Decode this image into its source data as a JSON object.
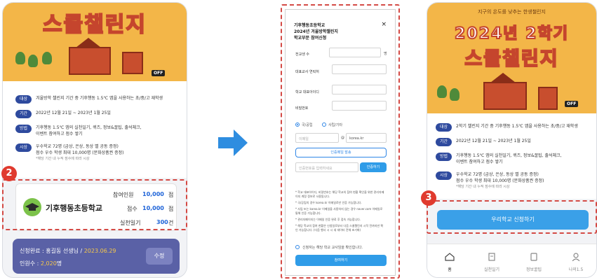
{
  "left": {
    "banner_title": "스쿨챌린지",
    "banner_off": "OFF",
    "info_rows": [
      {
        "tag": "대상",
        "text": "겨울방학 챌린지 기간 중 기후행동 1.5℃ 앱을 사용하는 초/중/고 재학생"
      },
      {
        "tag": "기간",
        "text": "2022년 12월 21일 ~ 2023년 1월 25일"
      },
      {
        "tag": "방법",
        "text": "기후행동 1.5℃ 앱의 실천일기, 퀴즈, 정보&꿀팁, 출석체크,",
        "text2": "이벤트 참여하고 점수 쌓기"
      },
      {
        "tag": "시상",
        "text": "우수학교 72명 (금상, 은상, 동상 별 공동 증정)",
        "text2": "점수 우수 학생 최대 10,000명 (문화상품권 증정)",
        "note": "*해당 기간 내 누적 점수에 따라 시상"
      }
    ],
    "badge": "2",
    "school": {
      "name": "기후행동초등학교",
      "participants_label": "참여인원",
      "participants_value": "10,000",
      "score_label": "점수",
      "score_value": "10,000",
      "days_label": "실천일기",
      "days_value": "300",
      "unit_person": "점",
      "unit_score": "점",
      "unit_days": "건"
    },
    "done": {
      "prefix": "신청완료 : 홍길동 선생님  /",
      "date": "2023.06.29",
      "count_label": "인원수 :",
      "count_value": "2,020",
      "count_unit": "명",
      "edit": "수정"
    }
  },
  "modal": {
    "title1": "기후행동초등학교",
    "title2": "2024년 겨울방학챌린지",
    "title3": "학교부문 참여신청",
    "close": "×",
    "label_students": "전교생 수",
    "unit_students": "명",
    "label_phone": "대표교사 연락처",
    "label_id": "학교 대표아이디",
    "label_pw": "비밀번호",
    "radio1": "국/공립",
    "radio2": "사립/기타",
    "email_placeholder": "이메일",
    "email_at": "@",
    "email_domain": "korea.kr",
    "send_code": "인증메일 발송",
    "code_placeholder": "인증번호를 입력하세요",
    "verify": "인증하기",
    "notes": [
      "* 학교 대표아이디, 비밀번호는 해당 학교의 참여 현황 확인을 위한 관리자페이지 계정 정보로 사용됩니다.",
      "* 국/공립의 경우 korea.kr 이메일로만 인증 가능합니다.",
      "* 사립 또는 korea.kr 이메일을 사용하지 않는 경우 naver.com 이메일로 통해 인증 가능합니다.",
      "* 관리자페이지는 이메일 인증 완료 후 접속 가능합니다.",
      "* 해당 학교의 참여 현황은 신청일로부터 다음 스쿨챌린지 시작 전까지만 확인 가능합니다. (다음 행사 시 시 새 데이터 전체 초기화)"
    ],
    "confirm": "신청자는 해당 학교 교사임을 확인합니다.",
    "submit": "참여하기"
  },
  "right": {
    "banner_sub": "지구의 온도를 낮추는 한생챌린지",
    "banner_year": "2024년 2학기",
    "banner_title": "스쿨챌린지",
    "banner_off": "OFF",
    "info_rows": [
      {
        "tag": "대상",
        "text": "2학기 챌린지 기간 중 기후행동 1.5℃ 앱을 사용하는 초/중/고 재학생"
      },
      {
        "tag": "기간",
        "text": "2022년 12월 21일 ~ 2023년 1월 25일"
      },
      {
        "tag": "방법",
        "text": "기후행동 1.5℃ 앱의 실천일기, 퀴즈, 정보&꿀팁, 출석체크,",
        "text2": "이벤트 참여하고 점수 쌓기"
      },
      {
        "tag": "시상",
        "text": "우수학교 72명 (금상, 은상, 동상 별 공동 증정)",
        "text2": "점수 우수 학생 최대 10,000명 (문화상품권 증정)",
        "note": "*해당 기간 내 누적 점수에 따라 시상"
      }
    ],
    "badge": "3",
    "apply": "우리학교 신청하기",
    "tabs": [
      {
        "label": "홈",
        "icon": "home-icon"
      },
      {
        "label": "실천일기",
        "icon": "diary-icon"
      },
      {
        "label": "정보꿀팁",
        "icon": "tips-icon"
      },
      {
        "label": "나의1.5",
        "icon": "person-icon"
      }
    ]
  },
  "colors": {
    "accent": "#3aa0e8",
    "tag": "#2e4a9e",
    "badge": "#e03a2e",
    "dashed": "#d44a45",
    "done_box": "#5a61a6",
    "banner": "#f3b648"
  }
}
